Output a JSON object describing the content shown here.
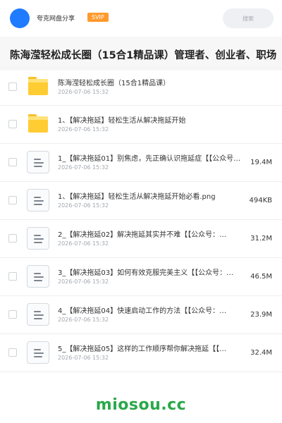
{
  "header": {
    "brand": "夸克网盘分享",
    "badge": "SVIP",
    "search_placeholder": "搜索"
  },
  "title": "陈海滢轻松成长圈（15合1精品课）管理者、创业者、职场",
  "files": [
    {
      "type": "folder",
      "icon": "folder-icon",
      "name": "陈海滢轻松成长圈（15合1精品课）",
      "date": "2026-07-06 15:32",
      "size": ""
    },
    {
      "type": "folder",
      "icon": "folder-icon",
      "name": "1、【解决拖延】轻松生活从解决拖延开始",
      "date": "2026-07-06 15:32",
      "size": ""
    },
    {
      "type": "file",
      "icon": "document-icon",
      "name": "1_【解决拖延01】别焦虑，先正确认识拖延症【【公众号：…",
      "date": "2026-07-06 15:32",
      "size": "19.4M"
    },
    {
      "type": "file",
      "icon": "document-icon",
      "name": "1、【解决拖延】轻松生活从解决拖延开始必看.png",
      "date": "2026-07-06 15:32",
      "size": "494KB"
    },
    {
      "type": "file",
      "icon": "document-icon",
      "name": "2_【解决拖延02】解决拖延其实并不难【【公众号：…",
      "date": "2026-07-06 15:32",
      "size": "31.2M"
    },
    {
      "type": "file",
      "icon": "document-icon",
      "name": "3_【解决拖延03】如何有效克服完美主义【【公众号：…",
      "date": "2026-07-06 15:32",
      "size": "46.5M"
    },
    {
      "type": "file",
      "icon": "document-icon",
      "name": "4_【解决拖延04】快速启动工作的方法【【公众号：…",
      "date": "2026-07-06 15:32",
      "size": "23.9M"
    },
    {
      "type": "file",
      "icon": "document-icon",
      "name": "5_【解决拖延05】这样的工作顺序帮你解决拖延【【…",
      "date": "2026-07-06 15:32",
      "size": "32.4M"
    }
  ],
  "watermark": "miosou.cc",
  "colors": {
    "accent": "#1f7bff",
    "badge": "#ff9a2e",
    "folder": "#ffcc33",
    "watermark": "#2aa84a"
  }
}
